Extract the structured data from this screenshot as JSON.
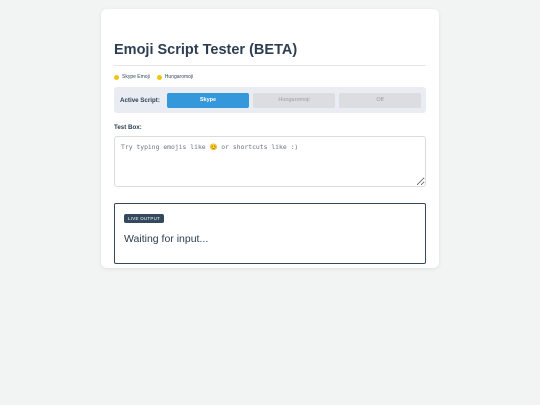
{
  "app": {
    "title": "Emoji Script Tester (BETA)"
  },
  "legend": {
    "items": [
      {
        "label": "Skype Emoji",
        "icon": "yellow-dot-icon",
        "color": "#f1c40f"
      },
      {
        "label": "Hungaromoji",
        "icon": "yellow-dot-icon",
        "color": "#f1c40f"
      }
    ]
  },
  "script_selector": {
    "label": "Active Script:",
    "options": [
      "Skype",
      "Hungaromoji",
      "Off"
    ],
    "selected": "Skype",
    "active_color": "#3498db"
  },
  "test_box": {
    "label": "Test Box:",
    "value": "",
    "placeholder": "Try typing emojis like 😊 or shortcuts like :)"
  },
  "output": {
    "badge": "LIVE OUTPUT",
    "text": "Waiting for input..."
  }
}
